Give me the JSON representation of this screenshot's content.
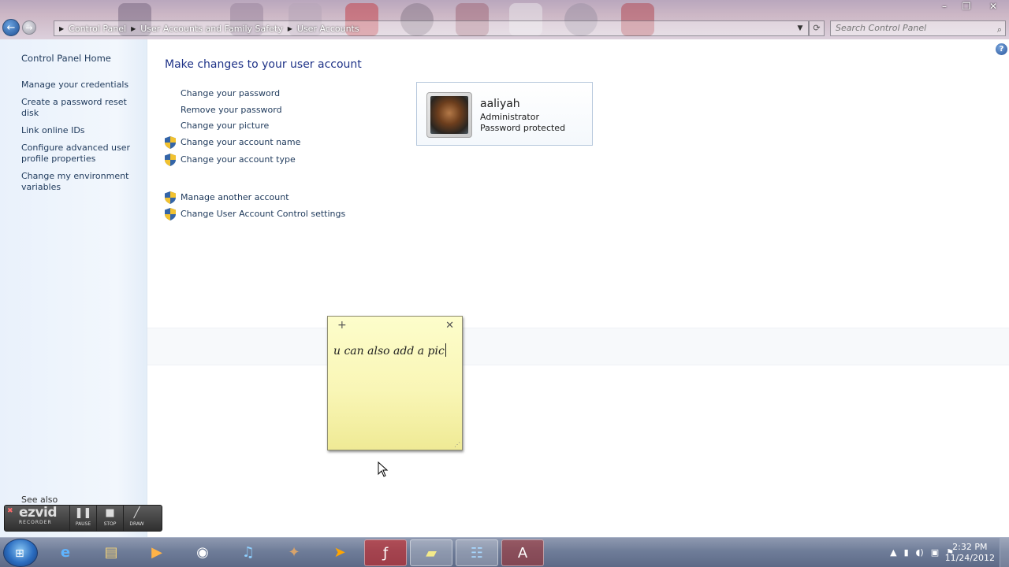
{
  "address_bar": {
    "crumbs": [
      "Control Panel",
      "User Accounts and Family Safety",
      "User Accounts"
    ]
  },
  "search": {
    "placeholder": "Search Control Panel"
  },
  "left_pane": {
    "home": "Control Panel Home",
    "links": [
      "Manage your credentials",
      "Create a password reset disk",
      "Link online IDs",
      "Configure advanced user profile properties",
      "Change my environment variables"
    ],
    "see_also": "See also"
  },
  "main": {
    "title": "Make changes to your user account",
    "tasks": [
      "Change your password",
      "Remove your password",
      "Change your picture",
      "Change your account name",
      "Change your account type"
    ],
    "other_tasks": [
      "Manage another account",
      "Change User Account Control settings"
    ]
  },
  "account": {
    "name": "aaliyah",
    "role": "Administrator",
    "status": "Password protected"
  },
  "sticky_note": {
    "text": "u can also add a pic"
  },
  "recorder": {
    "logo": "ezvid",
    "logo_sub": "RECORDER",
    "buttons": [
      "PAUSE",
      "STOP",
      "DRAW"
    ]
  },
  "clock": {
    "time": "2:32 PM",
    "date": "11/24/2012"
  },
  "icons": {
    "back": "back-arrow-icon",
    "forward": "forward-arrow-icon",
    "search": "search-icon",
    "shield": "uac-shield-icon",
    "help": "help-icon"
  },
  "colors": {
    "link": "#1e395b",
    "title": "#1e3287",
    "sticky": "#f9f6b6"
  }
}
